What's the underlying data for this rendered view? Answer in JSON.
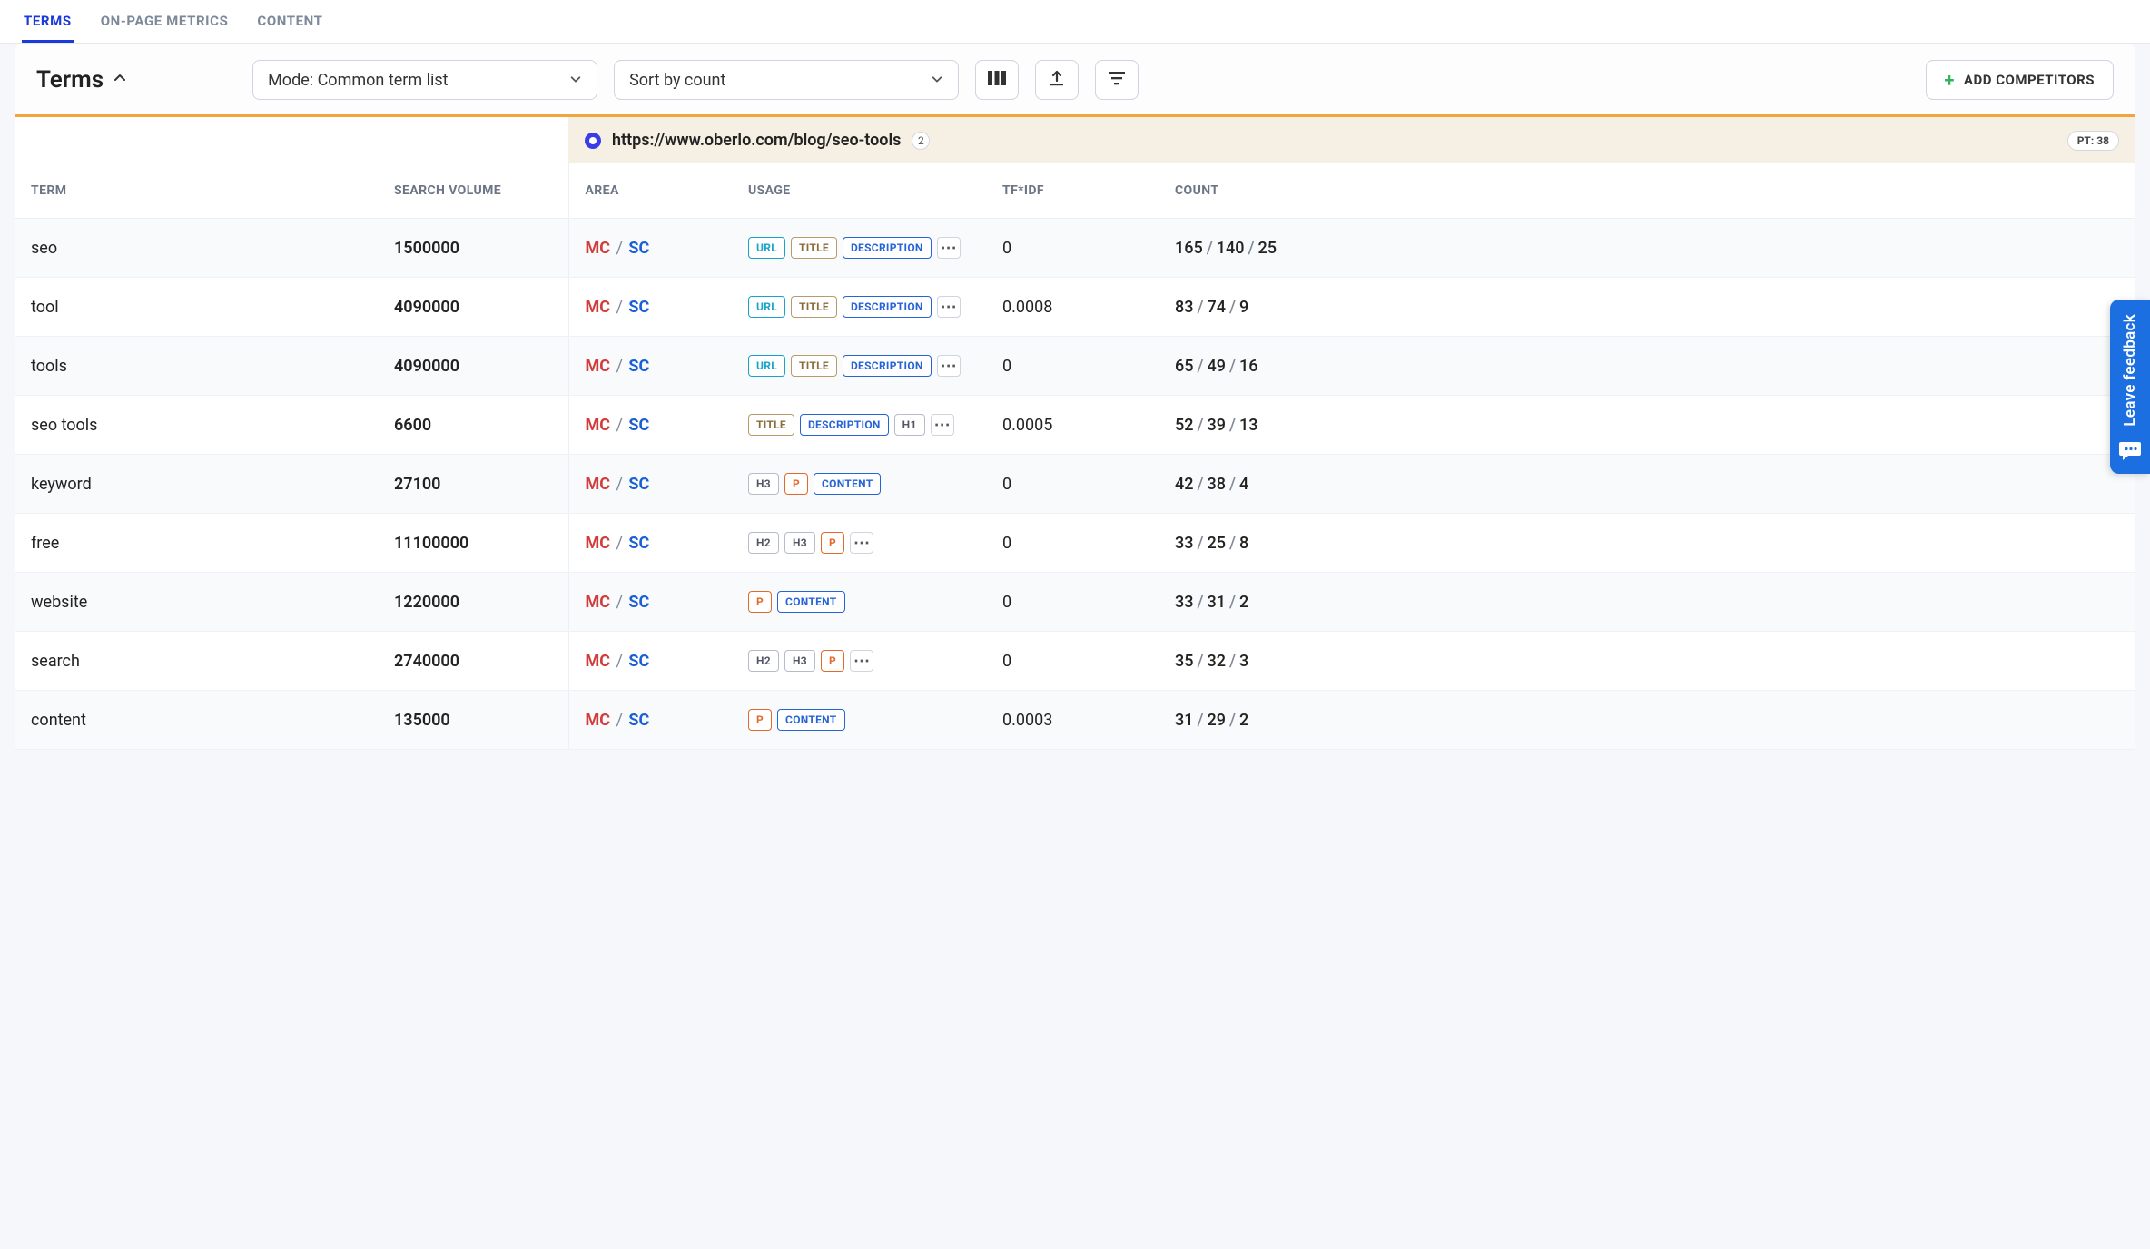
{
  "tabs": {
    "terms": "TERMS",
    "onpage": "ON-PAGE METRICS",
    "content": "CONTENT"
  },
  "title": "Terms",
  "mode_select": "Mode: Common term list",
  "sort_select": "Sort by count",
  "add_competitors": "ADD COMPETITORS",
  "url_band": {
    "url": "https://www.oberlo.com/blog/seo-tools",
    "count_badge": "2",
    "pt_badge": "PT: 38"
  },
  "headers": {
    "term": "TERM",
    "search_volume": "SEARCH VOLUME",
    "area": "AREA",
    "usage": "USAGE",
    "tfidf": "TF*IDF",
    "count": "COUNT"
  },
  "area_labels": {
    "mc": "MC",
    "sc": "SC"
  },
  "tag_labels": {
    "url": "URL",
    "title": "TITLE",
    "description": "DESCRIPTION",
    "h1": "H1",
    "h2": "H2",
    "h3": "H3",
    "p": "P",
    "content": "CONTENT"
  },
  "feedback": "Leave feedback",
  "rows": [
    {
      "term": "seo",
      "volume": "1500000",
      "tags": [
        "url",
        "title",
        "description"
      ],
      "more": true,
      "tfidf": "0",
      "count": [
        "165",
        "140",
        "25"
      ]
    },
    {
      "term": "tool",
      "volume": "4090000",
      "tags": [
        "url",
        "title",
        "description"
      ],
      "more": true,
      "tfidf": "0.0008",
      "count": [
        "83",
        "74",
        "9"
      ]
    },
    {
      "term": "tools",
      "volume": "4090000",
      "tags": [
        "url",
        "title",
        "description"
      ],
      "more": true,
      "tfidf": "0",
      "count": [
        "65",
        "49",
        "16"
      ]
    },
    {
      "term": "seo tools",
      "volume": "6600",
      "tags": [
        "title",
        "description",
        "h1"
      ],
      "more": true,
      "tfidf": "0.0005",
      "count": [
        "52",
        "39",
        "13"
      ]
    },
    {
      "term": "keyword",
      "volume": "27100",
      "tags": [
        "h3",
        "p",
        "content"
      ],
      "more": false,
      "tfidf": "0",
      "count": [
        "42",
        "38",
        "4"
      ]
    },
    {
      "term": "free",
      "volume": "11100000",
      "tags": [
        "h2",
        "h3",
        "p"
      ],
      "more": true,
      "tfidf": "0",
      "count": [
        "33",
        "25",
        "8"
      ]
    },
    {
      "term": "website",
      "volume": "1220000",
      "tags": [
        "p",
        "content"
      ],
      "more": false,
      "tfidf": "0",
      "count": [
        "33",
        "31",
        "2"
      ]
    },
    {
      "term": "search",
      "volume": "2740000",
      "tags": [
        "h2",
        "h3",
        "p"
      ],
      "more": true,
      "tfidf": "0",
      "count": [
        "35",
        "32",
        "3"
      ]
    },
    {
      "term": "content",
      "volume": "135000",
      "tags": [
        "p",
        "content"
      ],
      "more": false,
      "tfidf": "0.0003",
      "count": [
        "31",
        "29",
        "2"
      ]
    }
  ]
}
